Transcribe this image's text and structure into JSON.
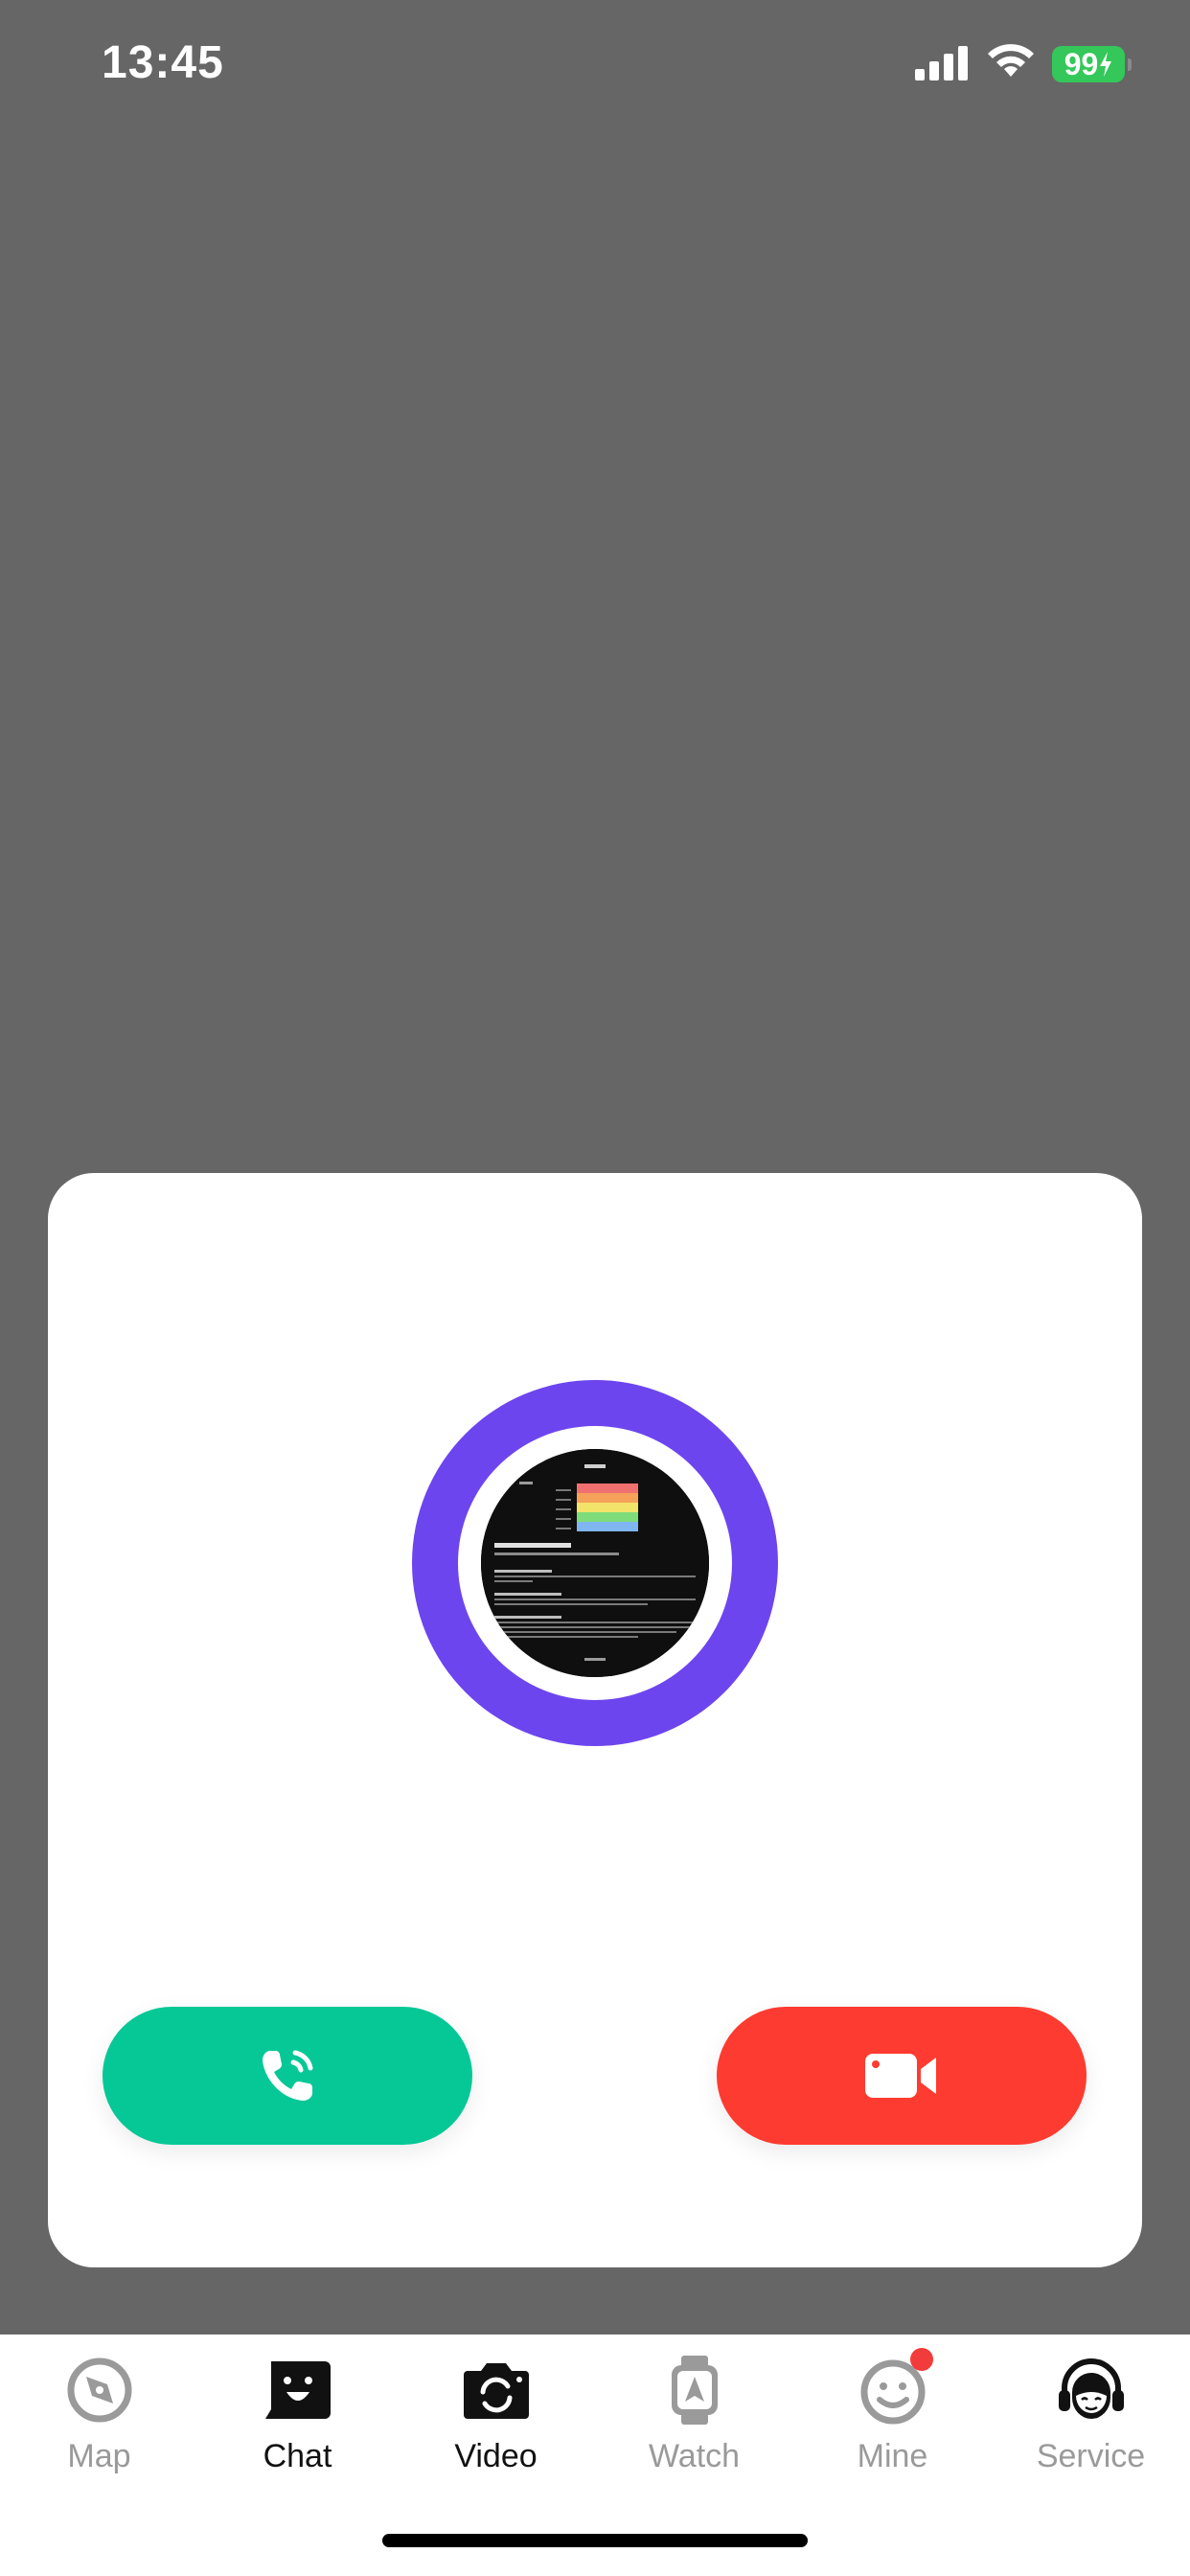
{
  "status_bar": {
    "time": "13:45",
    "battery": "99"
  },
  "call_card": {
    "avatar_description": "avatar-image",
    "buttons": {
      "voice_icon": "phone-icon",
      "video_icon": "video-camera-icon"
    }
  },
  "tab_bar": {
    "tabs": [
      {
        "label": "Map",
        "icon": "compass-icon",
        "active": false
      },
      {
        "label": "Chat",
        "icon": "chat-face-icon",
        "active": true
      },
      {
        "label": "Video",
        "icon": "camera-icon",
        "active": true
      },
      {
        "label": "Watch",
        "icon": "watch-icon",
        "active": false
      },
      {
        "label": "Mine",
        "icon": "smiley-icon",
        "active": false,
        "badge": true
      },
      {
        "label": "Service",
        "icon": "headset-icon",
        "active": false
      }
    ]
  },
  "colors": {
    "backdrop": "#666666",
    "accent_purple": "#6d45ee",
    "voice_green": "#06c896",
    "video_red": "#fe3b30",
    "battery_green": "#34c759",
    "badge_red": "#f23b3b"
  }
}
